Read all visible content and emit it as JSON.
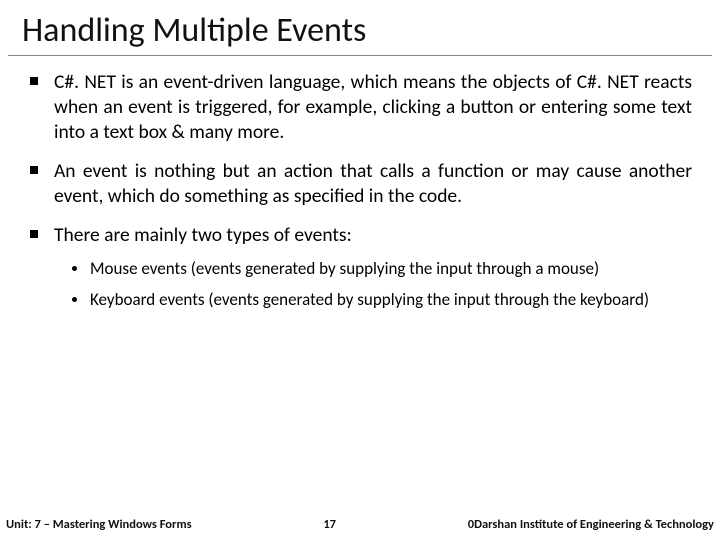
{
  "title": "Handling Multiple Events",
  "bullets": [
    "C#. NET is an event-driven language, which means the objects of C#. NET reacts when an event is triggered, for example, clicking a button or entering some text into a text box & many more.",
    "An event is nothing but an action that calls a function or may cause another event, which do something as specified in the code.",
    "There are mainly two types of events:"
  ],
  "sub_bullets": [
    "Mouse events (events generated by supplying the input through a mouse)",
    "Keyboard events (events generated by supplying the input through the keyboard)"
  ],
  "footer": {
    "left": "Unit: 7 – Mastering Windows Forms",
    "page": "17",
    "right": "0Darshan Institute of Engineering & Technology"
  }
}
